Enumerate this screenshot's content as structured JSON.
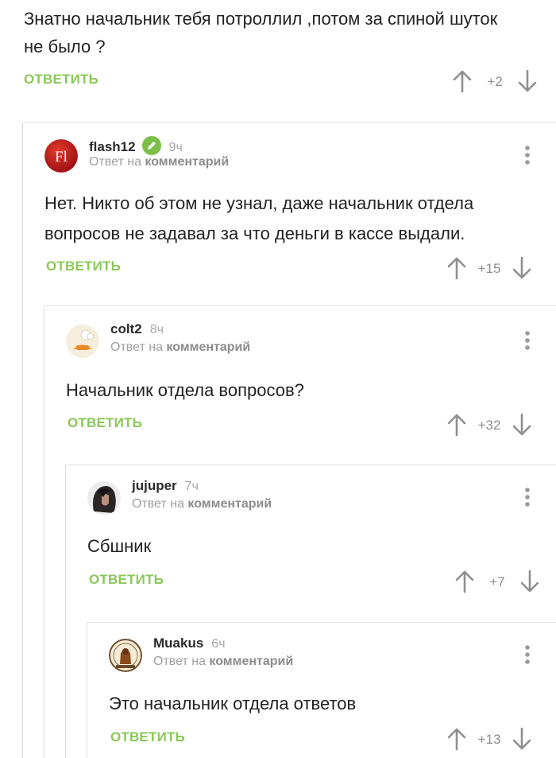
{
  "top_comment": {
    "text": "Знатно начальник тебя потроллил ,потом за спиной шуток не было ?",
    "reply_label": "ОТВЕТИТЬ",
    "score": "+2"
  },
  "comments": [
    {
      "username": "flash12",
      "time": "9ч",
      "reply_to_prefix": "Ответ на",
      "reply_to_link": "комментарий",
      "text": "Нет. Никто об этом не узнал, даже начальник отдела вопросов не задавал за что деньги в кассе выдали.",
      "reply_label": "ОТВЕТИТЬ",
      "score": "+15",
      "avatar_text": "Fl",
      "verified_icon": "verified-pencil-icon"
    },
    {
      "username": "colt2",
      "time": "8ч",
      "reply_to_prefix": "Ответ на",
      "reply_to_link": "комментарий",
      "text": "Начальник отдела вопросов?",
      "reply_label": "ОТВЕТИТЬ",
      "score": "+32"
    },
    {
      "username": "jujuper",
      "time": "7ч",
      "reply_to_prefix": "Ответ на",
      "reply_to_link": "комментарий",
      "text": "Сбшник",
      "reply_label": "ОТВЕТИТЬ",
      "score": "+7"
    },
    {
      "username": "Muakus",
      "time": "6ч",
      "reply_to_prefix": "Ответ на",
      "reply_to_link": "комментарий",
      "text": "Это начальник отдела ответов",
      "reply_label": "ОТВЕТИТЬ",
      "score": "+13"
    }
  ],
  "colors": {
    "reply_green": "#8ac858",
    "verified_green": "#7cc04a",
    "score_gray": "#8f8f8f",
    "thread_line": "#dcdcdc",
    "flash_avatar_red": "#c0141a"
  }
}
